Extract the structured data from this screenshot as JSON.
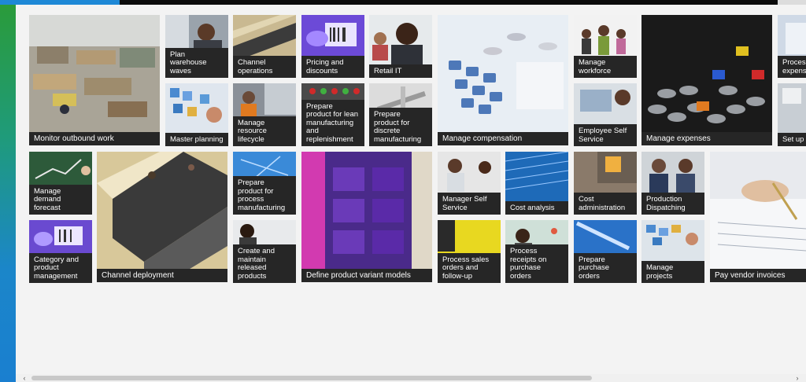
{
  "tiles": [
    {
      "label": "Monitor outbound work",
      "icon": "warehouse-photo"
    },
    {
      "label": "Plan warehouse waves",
      "icon": "phone-call-photo"
    },
    {
      "label": "Channel operations",
      "icon": "escalator-photo"
    },
    {
      "label": "Pricing and discounts",
      "icon": "barcode-scan-photo"
    },
    {
      "label": "Retail IT",
      "icon": "headset-agent-photo"
    },
    {
      "label": "Manage compensation",
      "icon": "calculator-photo"
    },
    {
      "label": "Manage workforce",
      "icon": "team-photo"
    },
    {
      "label": "Manage expenses",
      "icon": "coins-photo"
    },
    {
      "label": "Process expense",
      "icon": "expense-photo"
    },
    {
      "label": "Master planning",
      "icon": "sticky-notes-photo"
    },
    {
      "label": "Manage resource lifecycle",
      "icon": "worker-photo"
    },
    {
      "label": "Prepare product for lean manufacturing and replenishment",
      "icon": "kanban-lights-photo"
    },
    {
      "label": "Prepare product for discrete manufacturing",
      "icon": "calipers-photo"
    },
    {
      "label": "Employee Self Service",
      "icon": "laptop-photo"
    },
    {
      "label": "Set up manag",
      "icon": "notes-photo"
    },
    {
      "label": "Manage demand forecast",
      "icon": "chalkboard-photo"
    },
    {
      "label": "Channel deployment",
      "icon": "escalator-large-photo"
    },
    {
      "label": "Prepare product for process manufacturing",
      "icon": "blueprint-photo"
    },
    {
      "label": "Define product variant models",
      "icon": "boxes-photo"
    },
    {
      "label": "Manager Self Service",
      "icon": "meeting-photo"
    },
    {
      "label": "Cost analysis",
      "icon": "spreadsheet-photo"
    },
    {
      "label": "Cost administration",
      "icon": "keyboard-photo"
    },
    {
      "label": "Production Dispatching",
      "icon": "coworkers-photo"
    },
    {
      "label": "Pay vendor invoices",
      "icon": "signing-photo"
    },
    {
      "label": "Category and product management",
      "icon": "scanner-photo"
    },
    {
      "label": "Create and maintain released products",
      "icon": "person-photo"
    },
    {
      "label": "Process sales orders and follow-up",
      "icon": "yellow-phone-photo"
    },
    {
      "label": "Process receipts on purchase orders",
      "icon": "map-person-photo"
    },
    {
      "label": "Prepare purchase orders",
      "icon": "pen-photo"
    },
    {
      "label": "Manage projects",
      "icon": "planning-board-photo"
    }
  ],
  "scrollbar": {
    "left_arrow": "‹",
    "right_arrow": "›"
  }
}
